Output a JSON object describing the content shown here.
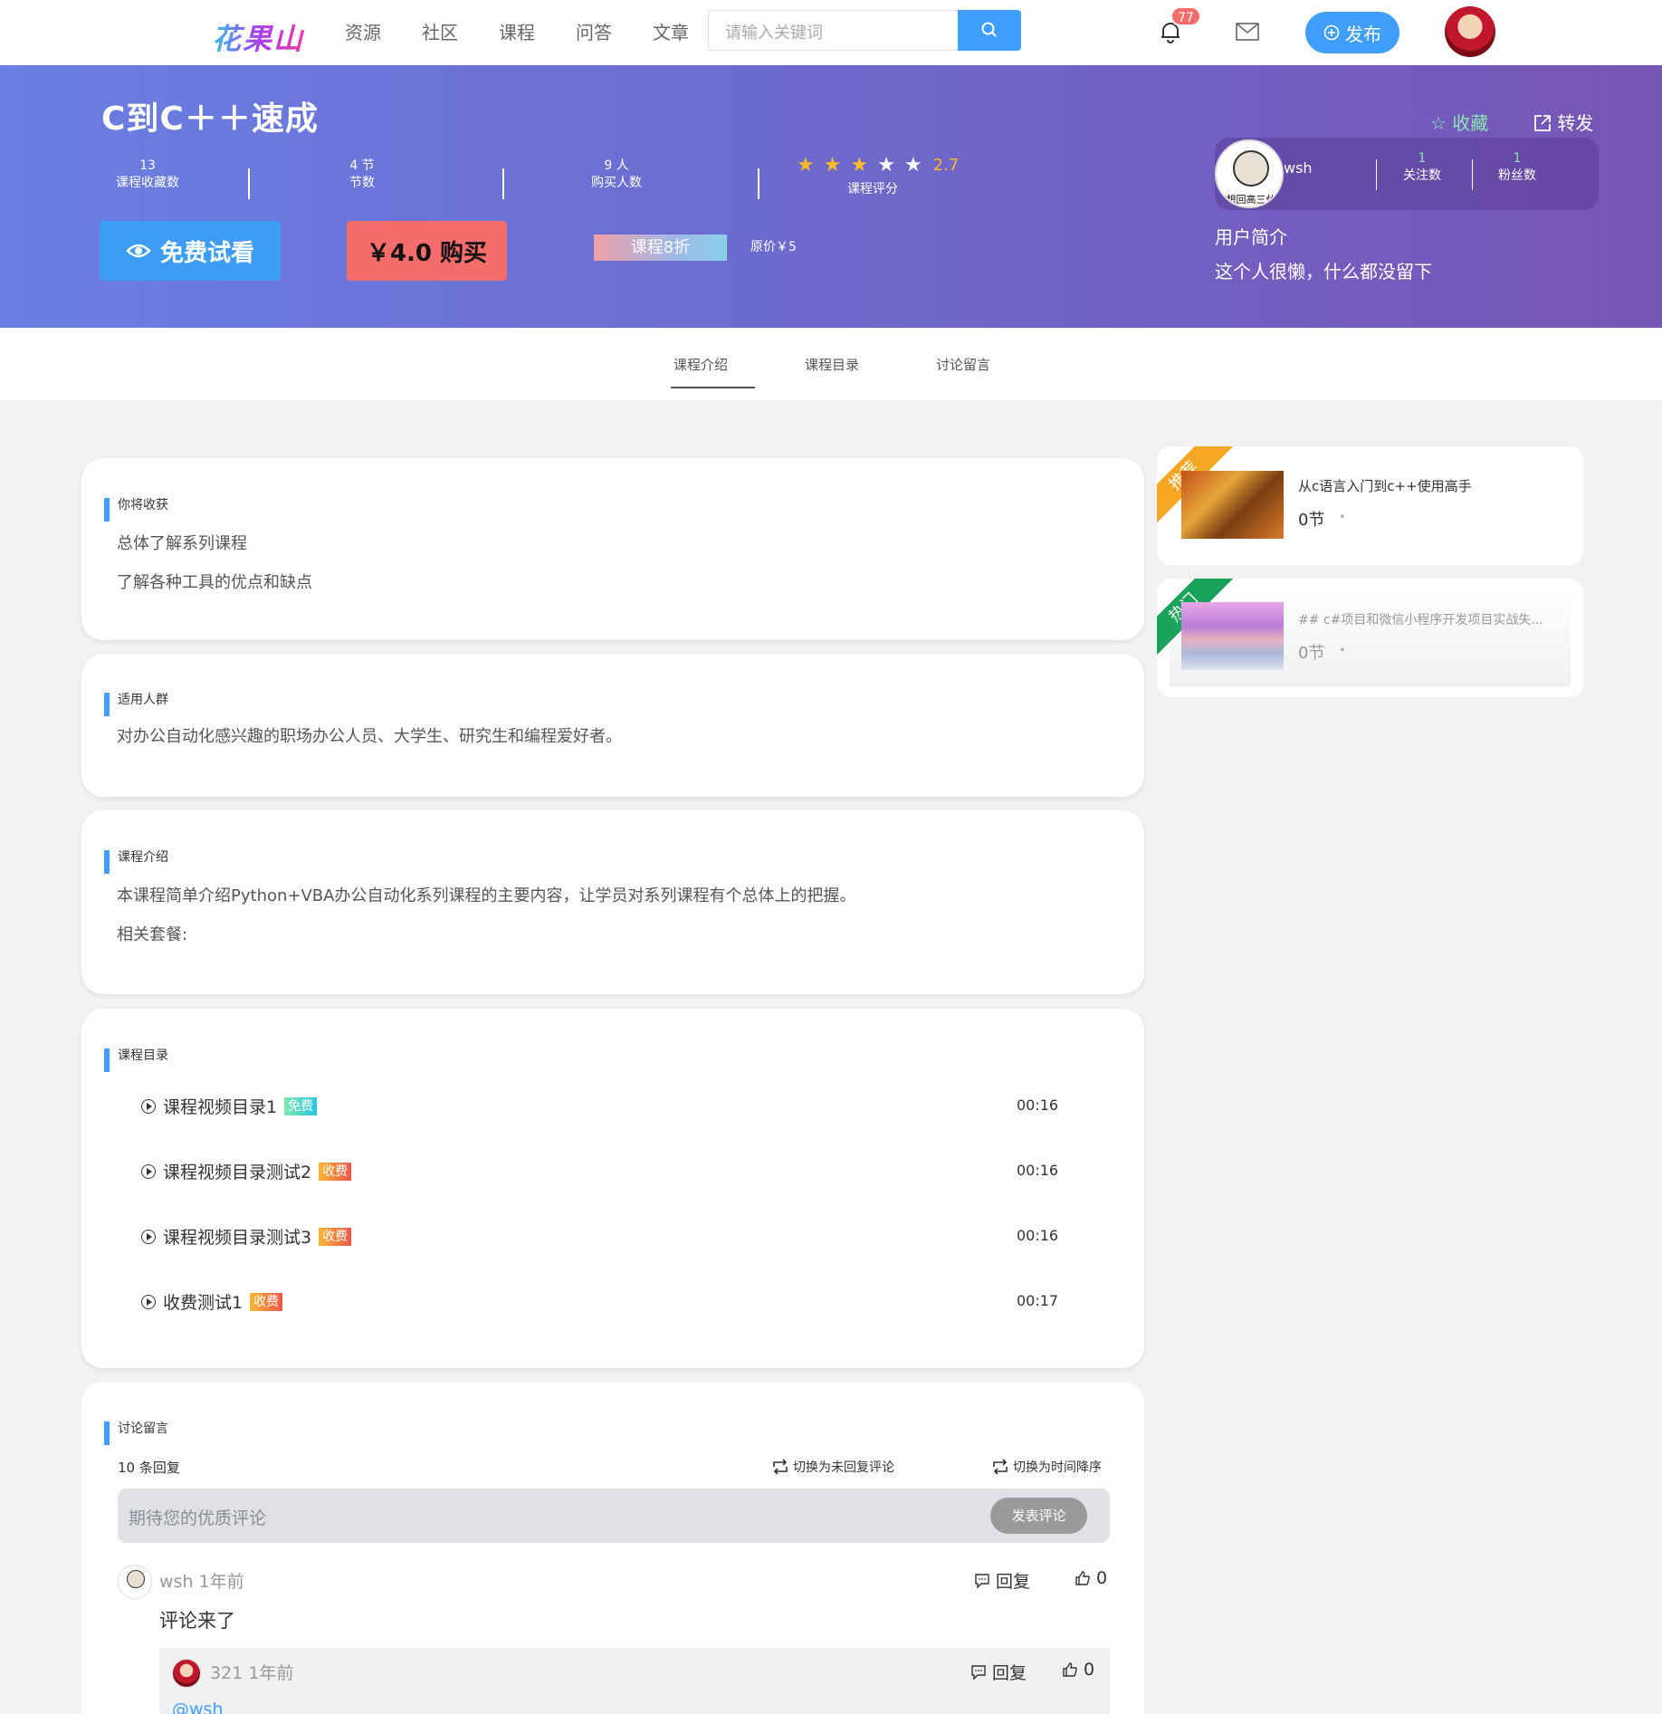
{
  "nav": {
    "logo": "花果山",
    "items": [
      "资源",
      "社区",
      "课程",
      "问答",
      "文章"
    ],
    "search_placeholder": "请输入关键词",
    "badge_count": "77",
    "publish_label": "发布"
  },
  "hero": {
    "title": "C到C＋＋速成",
    "stats": [
      {
        "value": "13",
        "label": "课程收藏数"
      },
      {
        "value": "4 节",
        "label": "节数"
      },
      {
        "value": "9 人",
        "label": "购买人数"
      }
    ],
    "rating": {
      "value": "2.7",
      "label": "课程评分",
      "stars": 5
    },
    "try_label": "免费试看",
    "buy_label": "￥4.0 购买",
    "discount_label": "课程8折",
    "original_price": "原价￥5",
    "collect_label": "收藏",
    "share_label": "转发",
    "user": {
      "name": "wsh",
      "avatar_caption": "想回高三休",
      "following": {
        "value": "1",
        "label": "关注数"
      },
      "followers": {
        "value": "1",
        "label": "粉丝数"
      }
    },
    "intro_label": "用户简介",
    "intro_text": "这个人很懒，什么都没留下"
  },
  "tabs": [
    "课程介绍",
    "课程目录",
    "讨论留言"
  ],
  "sections": {
    "gain": {
      "title": "你将收获",
      "lines": [
        "总体了解系列课程",
        "了解各种工具的优点和缺点"
      ]
    },
    "audience": {
      "title": "适用人群",
      "lines": [
        "对办公自动化感兴趣的职场办公人员、大学生、研究生和编程爱好者。"
      ]
    },
    "intro": {
      "title": "课程介绍",
      "lines": [
        "本课程简单介绍Python+VBA办公自动化系列课程的主要内容，让学员对系列课程有个总体上的把握。",
        "相关套餐:"
      ]
    },
    "toc": {
      "title": "课程目录",
      "items": [
        {
          "name": "课程视频目录1",
          "tag": "免费",
          "time": "00:16"
        },
        {
          "name": "课程视频目录测试2",
          "tag": "收费",
          "time": "00:16"
        },
        {
          "name": "课程视频目录测试3",
          "tag": "收费",
          "time": "00:16"
        },
        {
          "name": "收费测试1",
          "tag": "收费",
          "time": "00:17"
        }
      ]
    },
    "discussion": {
      "title": "讨论留言",
      "reply_count": "10 条回复",
      "switch_unreplied": "切换为未回复评论",
      "switch_time": "切换为时间降序",
      "input_placeholder": "期待您的优质评论",
      "post_label": "发表评论",
      "comments": [
        {
          "user": "wsh",
          "time": "1年前",
          "reply_label": "回复",
          "likes": "0",
          "body": "评论来了"
        },
        {
          "user": "321",
          "time": "1年前",
          "reply_label": "回复",
          "likes": "0",
          "mention": "@wsh"
        }
      ]
    }
  },
  "sidebar": [
    {
      "ribbon": "推荐",
      "ribbon_color": "#f5a623",
      "title": "从c语言入门到c++使用高手",
      "sub": "0节",
      "dot": "•"
    },
    {
      "ribbon": "热门",
      "ribbon_color": "#1aa35a",
      "title": "## c#项目和微信小程序开发项目实战失...",
      "sub": "0节",
      "dot": "•"
    }
  ],
  "colors": {
    "accent": "#409eff",
    "danger": "#f56c6c",
    "star": "#f7ba2a"
  }
}
